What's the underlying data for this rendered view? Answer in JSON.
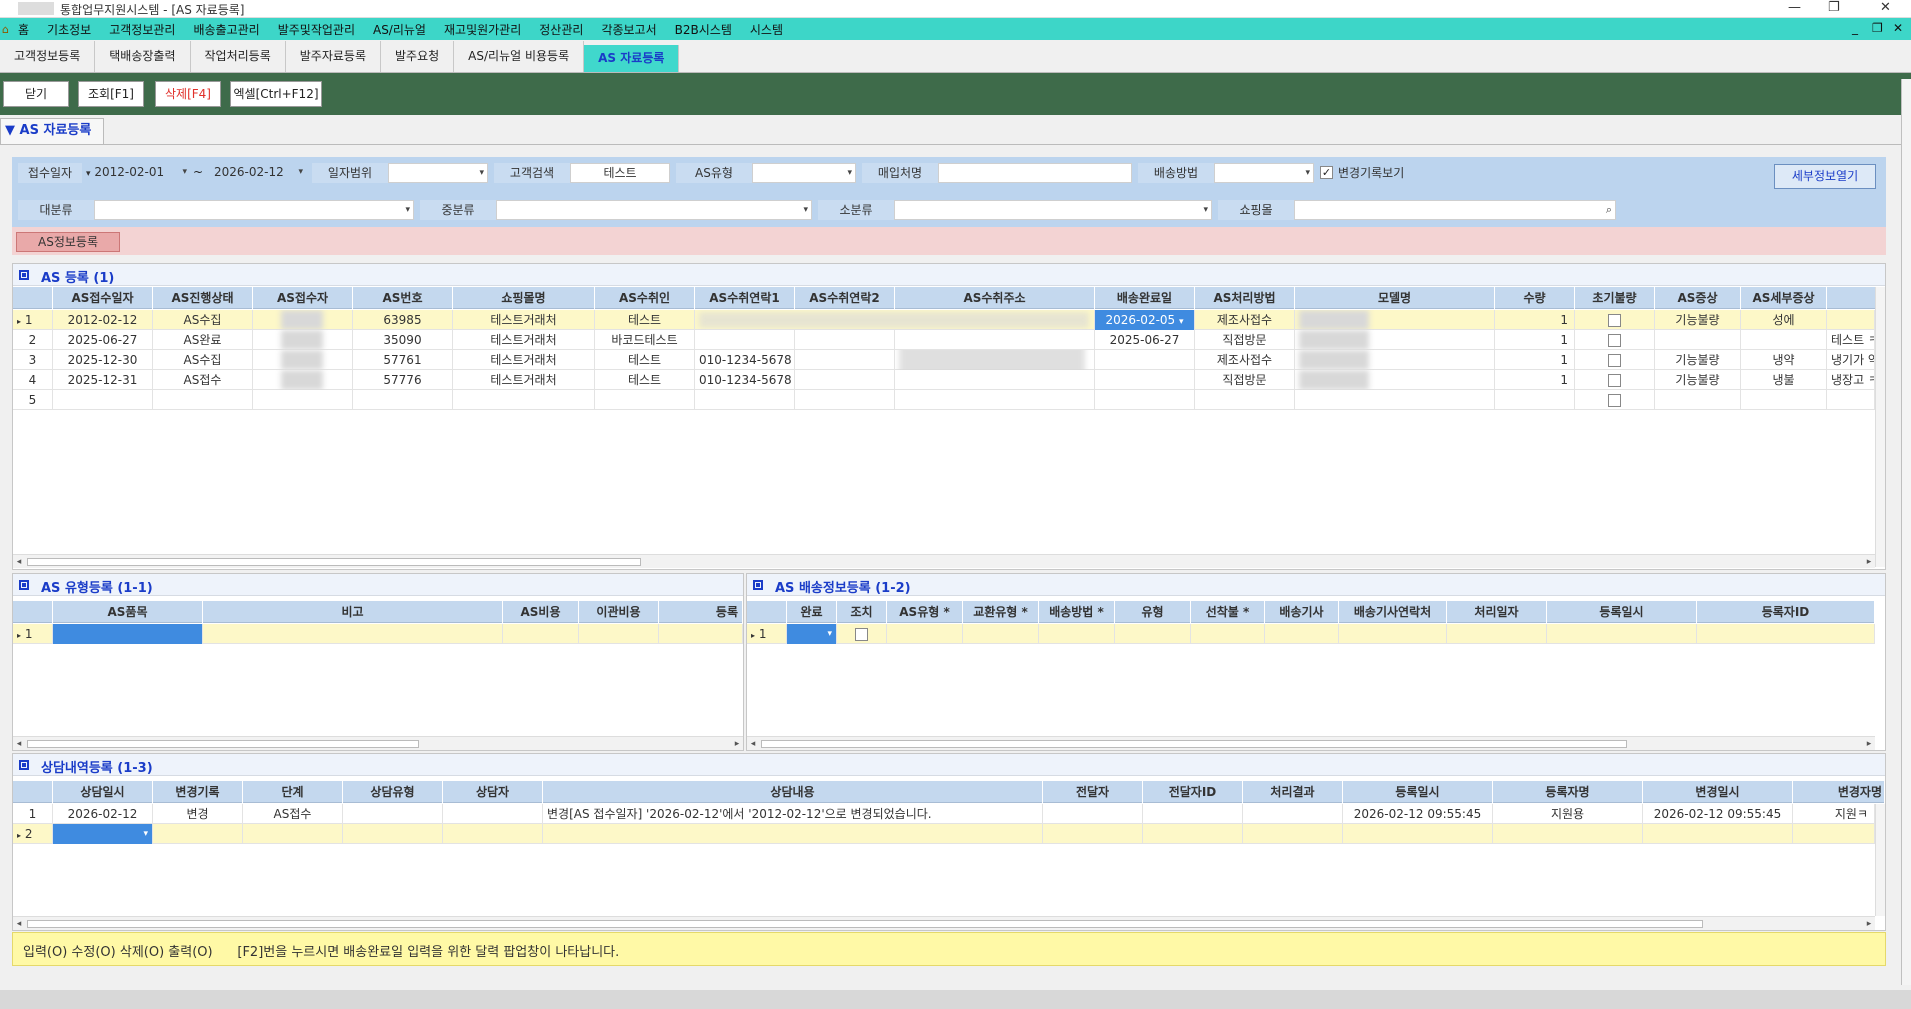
{
  "window": {
    "title": "통합업무지원시스템 - [AS 자료등록]",
    "controls": [
      "—",
      "❐",
      "✕"
    ],
    "mdi_controls": [
      "_",
      "❐",
      "✕"
    ]
  },
  "menu": [
    "홈",
    "기초정보",
    "고객정보관리",
    "배송출고관리",
    "발주및작업관리",
    "AS/리뉴얼",
    "재고및원가관리",
    "정산관리",
    "각종보고서",
    "B2B시스템",
    "시스템"
  ],
  "tabs": [
    {
      "label": "고객정보등록",
      "active": false
    },
    {
      "label": "택배송장출력",
      "active": false
    },
    {
      "label": "작업처리등록",
      "active": false
    },
    {
      "label": "발주자료등록",
      "active": false
    },
    {
      "label": "발주요청",
      "active": false
    },
    {
      "label": "AS/리뉴얼 비용등록",
      "active": false
    },
    {
      "label": "AS 자료등록",
      "active": true
    }
  ],
  "toolbar": {
    "close": "닫기",
    "search": "조회[F1]",
    "delete": "삭제[F4]",
    "excel": "엑셀[Ctrl+F12]"
  },
  "page_title": "AS 자료등록",
  "search": {
    "receipt_date_label": "접수일자",
    "date_from": "2012-02-01",
    "date_sep": "~",
    "date_to": "2026-02-12",
    "date_range_label": "일자범위",
    "date_range_value": "",
    "customer_search_label": "고객검색",
    "customer_search_value": "테스트",
    "as_type_label": "AS유형",
    "as_type_value": "",
    "purchaser_label": "매입처명",
    "purchaser_value": "",
    "delivery_method_label": "배송방법",
    "delivery_method_value": "",
    "history_label": "변경기록보기",
    "history_checked": true,
    "detail_button": "세부정보열기",
    "major_cat_label": "대분류",
    "mid_cat_label": "중분류",
    "minor_cat_label": "소분류",
    "mall_label": "쇼핑몰",
    "mall_value": ""
  },
  "as_info_button": "AS정보등록",
  "as_register": {
    "title": "AS 등록 (1)",
    "columns": [
      "AS접수일자",
      "AS진행상태",
      "AS접수자",
      "AS번호",
      "쇼핑몰명",
      "AS수취인",
      "AS수취연락1",
      "AS수취연락2",
      "AS수취주소",
      "배송완료일",
      "AS처리방법",
      "모델명",
      "수량",
      "초기불량",
      "AS증상",
      "AS세부증상"
    ],
    "rows": [
      {
        "no": "1",
        "date": "2012-02-12",
        "status": "AS수집",
        "receiver": "",
        "as_no": "63985",
        "mall": "테스트거래처",
        "recipient": "테스트",
        "tel1": "",
        "tel2": "",
        "addr": "",
        "delivered": "2026-02-05",
        "method": "제조사접수",
        "model": "",
        "qty": "1",
        "defect": false,
        "symptom": "기능불량",
        "detail": "성에",
        "extra": ""
      },
      {
        "no": "2",
        "date": "2025-06-27",
        "status": "AS완료",
        "receiver": "",
        "as_no": "35090",
        "mall": "테스트거래처",
        "recipient": "바코드테스트",
        "tel1": "",
        "tel2": "",
        "addr": "",
        "delivered": "2025-06-27",
        "method": "직접방문",
        "model": "",
        "qty": "1",
        "defect": false,
        "symptom": "",
        "detail": "",
        "extra": "테스트 ㅋ"
      },
      {
        "no": "3",
        "date": "2025-12-30",
        "status": "AS수집",
        "receiver": "",
        "as_no": "57761",
        "mall": "테스트거래처",
        "recipient": "테스트",
        "tel1": "010-1234-5678",
        "tel2": "",
        "addr": "",
        "delivered": "",
        "method": "제조사접수",
        "model": "",
        "qty": "1",
        "defect": false,
        "symptom": "기능불량",
        "detail": "냉약",
        "extra": "냉기가 약"
      },
      {
        "no": "4",
        "date": "2025-12-31",
        "status": "AS접수",
        "receiver": "",
        "as_no": "57776",
        "mall": "테스트거래처",
        "recipient": "테스트",
        "tel1": "010-1234-5678",
        "tel2": "",
        "addr": "",
        "delivered": "",
        "method": "직접방문",
        "model": "",
        "qty": "1",
        "defect": false,
        "symptom": "기능불량",
        "detail": "냉불",
        "extra": "냉장고 ㅋ"
      },
      {
        "no": "5",
        "date": "",
        "status": "",
        "receiver": "",
        "as_no": "",
        "mall": "",
        "recipient": "",
        "tel1": "",
        "tel2": "",
        "addr": "",
        "delivered": "",
        "method": "",
        "model": "",
        "qty": "",
        "defect": false,
        "symptom": "",
        "detail": "",
        "extra": ""
      }
    ]
  },
  "as_type": {
    "title": "AS 유형등록 (1-1)",
    "columns": [
      "AS품목",
      "비고",
      "AS비용",
      "이관비용",
      "등록"
    ],
    "rows": [
      {
        "no": "1"
      }
    ]
  },
  "as_delivery": {
    "title": "AS 배송정보등록 (1-2)",
    "columns": [
      "완료",
      "조치",
      "AS유형 *",
      "교환유형 *",
      "배송방법 *",
      "유형",
      "선착불 *",
      "배송기사",
      "배송기사연락처",
      "처리일자",
      "등록일시",
      "등록자ID"
    ],
    "rows": [
      {
        "no": "1"
      }
    ]
  },
  "consult": {
    "title": "상담내역등록 (1-3)",
    "columns": [
      "상담일시",
      "변경기록",
      "단계",
      "상담유형",
      "상담자",
      "상담내용",
      "전달자",
      "전달자ID",
      "처리결과",
      "등록일시",
      "등록자명",
      "변경일시",
      "변경자명"
    ],
    "rows": [
      {
        "no": "1",
        "date": "2026-02-12",
        "change": "변경",
        "stage": "AS접수",
        "type": "",
        "person": "",
        "content": "변경[AS 접수일자] '2026-02-12'에서 '2012-02-12'으로 변경되었습니다.",
        "deliver": "",
        "deliver_id": "",
        "result": "",
        "reg_time": "2026-02-12 09:55:45",
        "reg_name": "지원용",
        "mod_time": "2026-02-12 09:55:45",
        "mod_name": "지원ㅋ"
      },
      {
        "no": "2"
      }
    ]
  },
  "status_text": "입력(O) 수정(O) 삭제(O) 출력(O)      [F2]번을 누르시면 배송완료일 입력을 위한 달력 팝업창이 나타납니다.",
  "colors": {
    "menu_bg": "#3dd6c8",
    "toolbar_bg": "#3e6b4a",
    "header_bg": "#c4d8ee",
    "selected_row": "#fdf8c8",
    "accent": "#1a3cc8"
  }
}
